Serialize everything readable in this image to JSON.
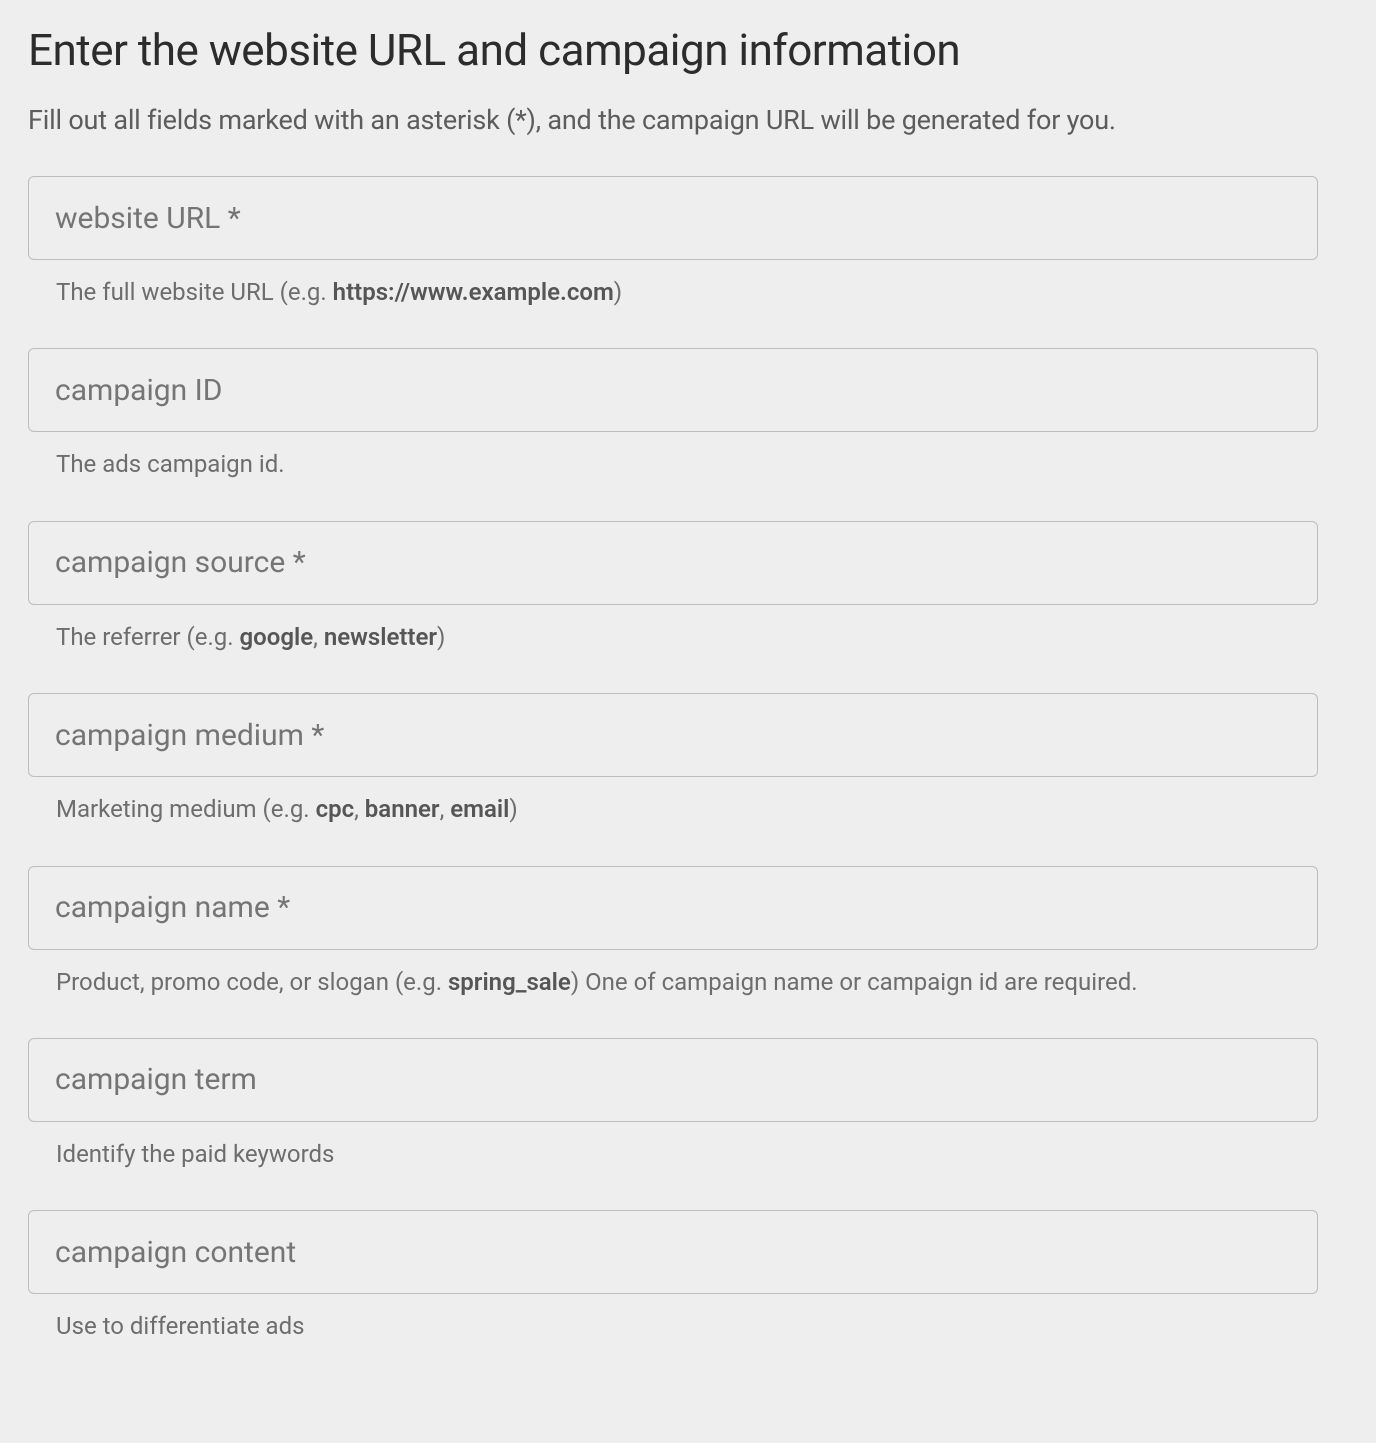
{
  "heading": "Enter the website URL and campaign information",
  "subheading": "Fill out all fields marked with an asterisk (*), and the campaign URL will be generated for you.",
  "fields": {
    "website_url": {
      "placeholder": "website URL *",
      "helper_prefix": "The full website URL (e.g. ",
      "helper_bold_1": "https://www.example.com",
      "helper_suffix": ")"
    },
    "campaign_id": {
      "placeholder": "campaign ID",
      "helper": "The ads campaign id."
    },
    "campaign_source": {
      "placeholder": "campaign source *",
      "helper_prefix": "The referrer (e.g. ",
      "helper_bold_1": "google",
      "helper_sep_1": ", ",
      "helper_bold_2": "newsletter",
      "helper_suffix": ")"
    },
    "campaign_medium": {
      "placeholder": "campaign medium *",
      "helper_prefix": "Marketing medium (e.g. ",
      "helper_bold_1": "cpc",
      "helper_sep_1": ", ",
      "helper_bold_2": "banner",
      "helper_sep_2": ", ",
      "helper_bold_3": "email",
      "helper_suffix": ")"
    },
    "campaign_name": {
      "placeholder": "campaign name *",
      "helper_prefix": "Product, promo code, or slogan (e.g. ",
      "helper_bold_1": "spring_sale",
      "helper_suffix": ") One of campaign name or campaign id are required."
    },
    "campaign_term": {
      "placeholder": "campaign term",
      "helper": "Identify the paid keywords"
    },
    "campaign_content": {
      "placeholder": "campaign content",
      "helper": "Use to differentiate ads"
    }
  }
}
